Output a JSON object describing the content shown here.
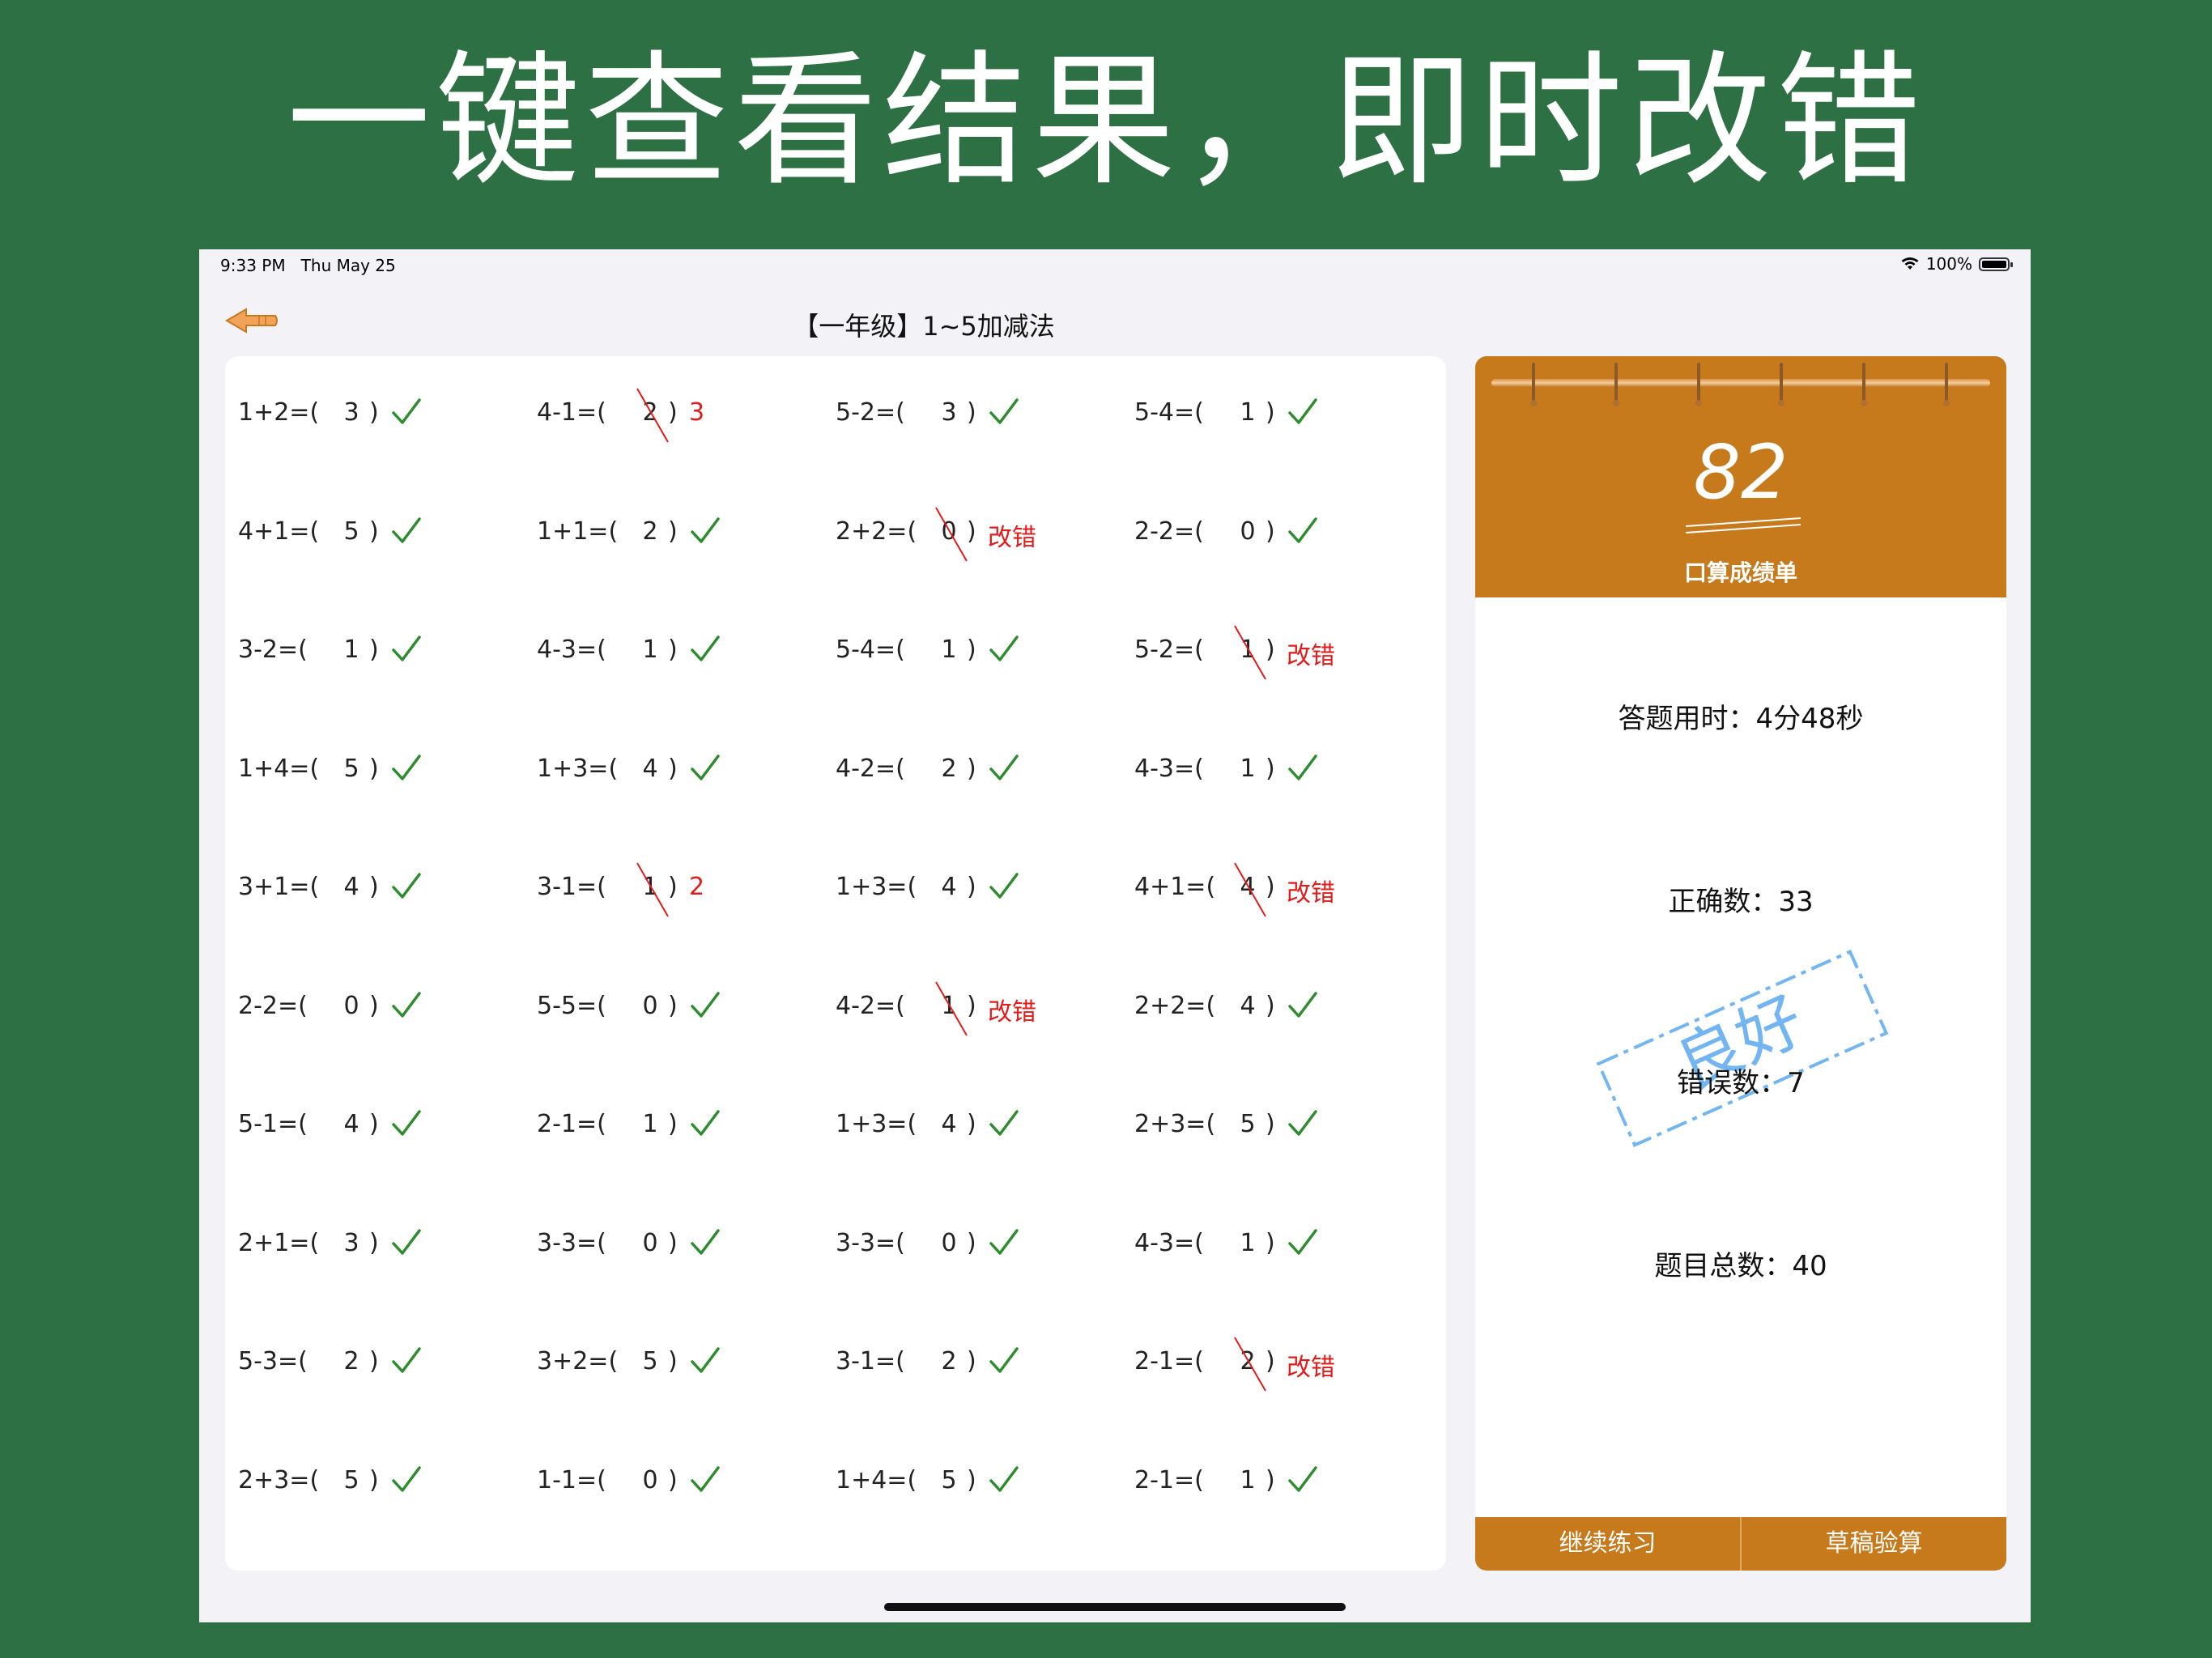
{
  "headline": "一键查看结果，即时改错",
  "status": {
    "time": "9:33 PM",
    "date": "Thu May 25",
    "battery": "100%"
  },
  "nav": {
    "title": "【一年级】1~5加减法",
    "back_icon": "back-arrow-icon"
  },
  "quiz": {
    "columns": [
      [
        {
          "q": "1+2=(",
          "a": "3",
          "status": "correct"
        },
        {
          "q": "4+1=(",
          "a": "5",
          "status": "correct"
        },
        {
          "q": "3-2=(",
          "a": "1",
          "status": "correct"
        },
        {
          "q": "1+4=(",
          "a": "5",
          "status": "correct"
        },
        {
          "q": "3+1=(",
          "a": "4",
          "status": "correct"
        },
        {
          "q": "2-2=(",
          "a": "0",
          "status": "correct"
        },
        {
          "q": "5-1=(",
          "a": "4",
          "status": "correct"
        },
        {
          "q": "2+1=(",
          "a": "3",
          "status": "correct"
        },
        {
          "q": "5-3=(",
          "a": "2",
          "status": "correct"
        },
        {
          "q": "2+3=(",
          "a": "5",
          "status": "correct"
        }
      ],
      [
        {
          "q": "4-1=(",
          "a": "2",
          "status": "wrong",
          "fix": "3"
        },
        {
          "q": "1+1=(",
          "a": "2",
          "status": "correct"
        },
        {
          "q": "4-3=(",
          "a": "1",
          "status": "correct"
        },
        {
          "q": "1+3=(",
          "a": "4",
          "status": "correct"
        },
        {
          "q": "3-1=(",
          "a": "1",
          "status": "wrong",
          "fix": "2"
        },
        {
          "q": "5-5=(",
          "a": "0",
          "status": "correct"
        },
        {
          "q": "2-1=(",
          "a": "1",
          "status": "correct"
        },
        {
          "q": "3-3=(",
          "a": "0",
          "status": "correct"
        },
        {
          "q": "3+2=(",
          "a": "5",
          "status": "correct"
        },
        {
          "q": "1-1=(",
          "a": "0",
          "status": "correct"
        }
      ],
      [
        {
          "q": "5-2=(",
          "a": "3",
          "status": "correct"
        },
        {
          "q": "2+2=(",
          "a": "0",
          "status": "wrong",
          "fix": "改错"
        },
        {
          "q": "5-4=(",
          "a": "1",
          "status": "correct"
        },
        {
          "q": "4-2=(",
          "a": "2",
          "status": "correct"
        },
        {
          "q": "1+3=(",
          "a": "4",
          "status": "correct"
        },
        {
          "q": "4-2=(",
          "a": "1",
          "status": "wrong",
          "fix": "改错"
        },
        {
          "q": "1+3=(",
          "a": "4",
          "status": "correct"
        },
        {
          "q": "3-3=(",
          "a": "0",
          "status": "correct"
        },
        {
          "q": "3-1=(",
          "a": "2",
          "status": "correct"
        },
        {
          "q": "1+4=(",
          "a": "5",
          "status": "correct"
        }
      ],
      [
        {
          "q": "5-4=(",
          "a": "1",
          "status": "correct"
        },
        {
          "q": "2-2=(",
          "a": "0",
          "status": "correct"
        },
        {
          "q": "5-2=(",
          "a": "1",
          "status": "wrong",
          "fix": "改错"
        },
        {
          "q": "4-3=(",
          "a": "1",
          "status": "correct"
        },
        {
          "q": "4+1=(",
          "a": "4",
          "status": "wrong",
          "fix": "改错"
        },
        {
          "q": "2+2=(",
          "a": "4",
          "status": "correct"
        },
        {
          "q": "2+3=(",
          "a": "5",
          "status": "correct"
        },
        {
          "q": "4-3=(",
          "a": "1",
          "status": "correct"
        },
        {
          "q": "2-1=(",
          "a": "2",
          "status": "wrong",
          "fix": "改错"
        },
        {
          "q": "2-1=(",
          "a": "1",
          "status": "correct"
        }
      ]
    ],
    "close_paren": ")"
  },
  "report": {
    "score": "82",
    "title": "口算成绩单",
    "time_label": "答题用时：4分48秒",
    "correct_label": "正确数：33",
    "wrong_label": "错误数：7",
    "total_label": "题目总数：40",
    "stamp_text": "良好",
    "buttons": {
      "continue": "继续练习",
      "scratch": "草稿验算"
    }
  },
  "colors": {
    "background": "#2d7043",
    "accent": "#c77a1c",
    "correct": "#2e8b2e",
    "wrong": "#e21b1b",
    "stamp": "#5aa9ee"
  }
}
